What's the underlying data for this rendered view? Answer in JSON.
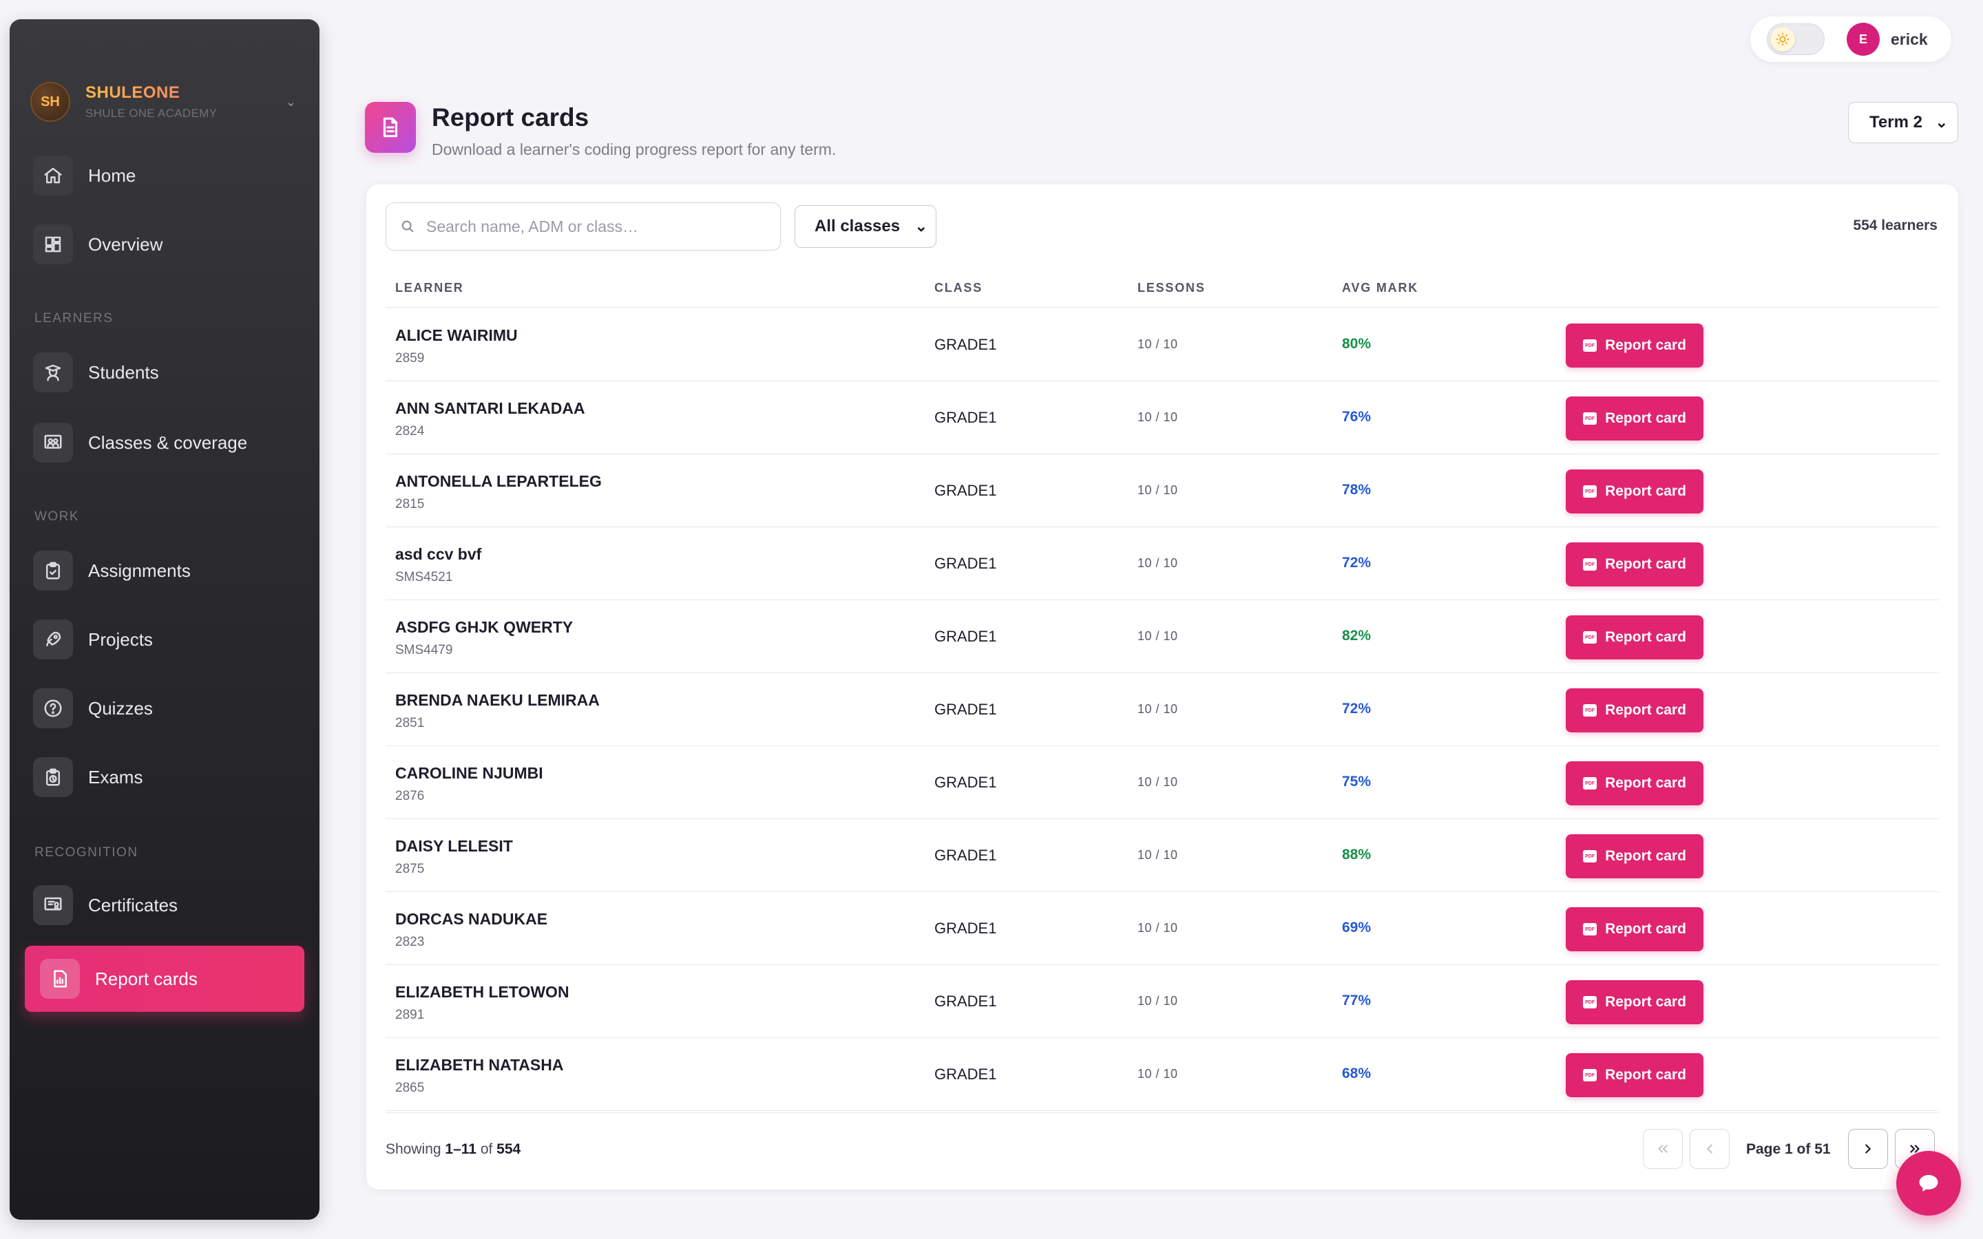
{
  "school": {
    "initials": "SH",
    "name": "SHULEONE",
    "subtitle": "SHULE ONE ACADEMY"
  },
  "nav": {
    "home": "Home",
    "overview": "Overview",
    "section_learners": "LEARNERS",
    "students": "Students",
    "classes": "Classes & coverage",
    "section_work": "WORK",
    "assignments": "Assignments",
    "projects": "Projects",
    "quizzes": "Quizzes",
    "exams": "Exams",
    "section_recognition": "RECOGNITION",
    "certificates": "Certificates",
    "report_cards": "Report cards"
  },
  "user": {
    "initial": "E",
    "name": "erick"
  },
  "page": {
    "title": "Report cards",
    "subtitle": "Download a learner's coding progress report for any term.",
    "term": "Term 2"
  },
  "filters": {
    "search_placeholder": "Search name, ADM or class…",
    "class_filter": "All classes",
    "learner_count": "554 learners"
  },
  "table": {
    "headers": {
      "learner": "LEARNER",
      "class": "CLASS",
      "lessons": "LESSONS",
      "avg": "AVG MARK"
    },
    "action_label": "Report card",
    "rows": [
      {
        "name": "ALICE WAIRIMU",
        "adm": "2859",
        "class": "GRADE1",
        "lessons": "10 / 10",
        "avg": "80%"
      },
      {
        "name": "ANN SANTARI LEKADAA",
        "adm": "2824",
        "class": "GRADE1",
        "lessons": "10 / 10",
        "avg": "76%"
      },
      {
        "name": "ANTONELLA LEPARTELEG",
        "adm": "2815",
        "class": "GRADE1",
        "lessons": "10 / 10",
        "avg": "78%"
      },
      {
        "name": "asd ccv bvf",
        "adm": "SMS4521",
        "class": "GRADE1",
        "lessons": "10 / 10",
        "avg": "72%"
      },
      {
        "name": "ASDFG GHJK QWERTY",
        "adm": "SMS4479",
        "class": "GRADE1",
        "lessons": "10 / 10",
        "avg": "82%"
      },
      {
        "name": "BRENDA NAEKU LEMIRAA",
        "adm": "2851",
        "class": "GRADE1",
        "lessons": "10 / 10",
        "avg": "72%"
      },
      {
        "name": "CAROLINE NJUMBI",
        "adm": "2876",
        "class": "GRADE1",
        "lessons": "10 / 10",
        "avg": "75%"
      },
      {
        "name": "DAISY LELESIT",
        "adm": "2875",
        "class": "GRADE1",
        "lessons": "10 / 10",
        "avg": "88%"
      },
      {
        "name": "DORCAS NADUKAE",
        "adm": "2823",
        "class": "GRADE1",
        "lessons": "10 / 10",
        "avg": "69%"
      },
      {
        "name": "ELIZABETH LETOWON",
        "adm": "2891",
        "class": "GRADE1",
        "lessons": "10 / 10",
        "avg": "77%"
      },
      {
        "name": "ELIZABETH NATASHA",
        "adm": "2865",
        "class": "GRADE1",
        "lessons": "10 / 10",
        "avg": "68%"
      }
    ]
  },
  "pagination": {
    "showing_prefix": "Showing",
    "showing_range": "1–11",
    "showing_of": "of",
    "total": "554",
    "page_label": "Page 1 of 51"
  },
  "colors": {
    "accent": "#e0246f",
    "avg_high": "#16904a",
    "avg_mid": "#2459d6"
  }
}
